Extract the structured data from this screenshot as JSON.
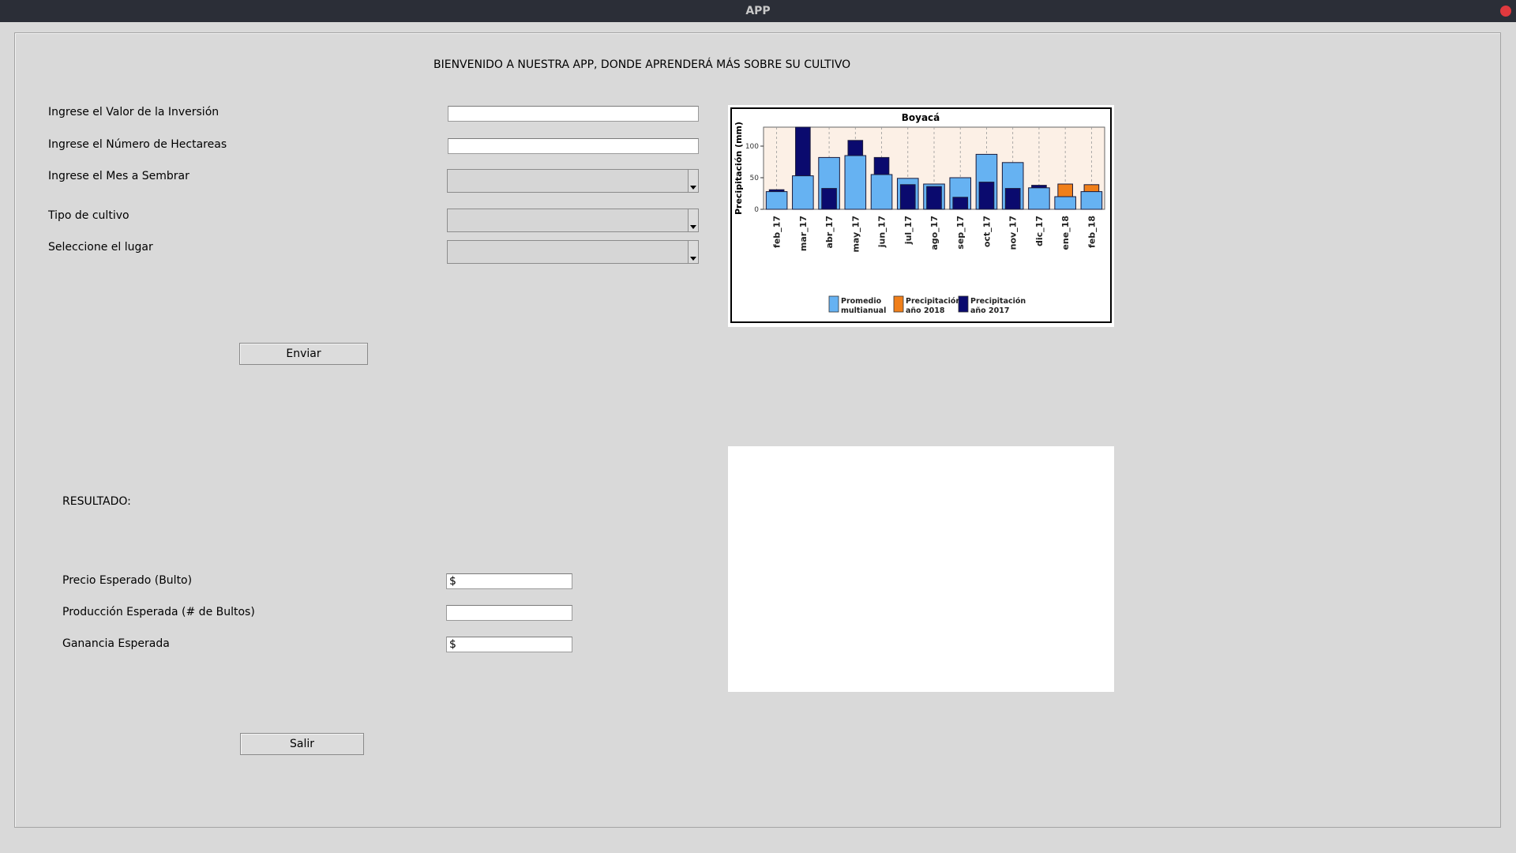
{
  "window": {
    "title": "APP"
  },
  "welcome": "BIENVENIDO A NUESTRA APP, DONDE APRENDERÁ MÁS SOBRE SU CULTIVO",
  "form": {
    "investment_label": "Ingrese el Valor de la Inversión",
    "investment_value": "",
    "hectares_label": "Ingrese el Número de Hectareas",
    "hectares_value": "",
    "month_label": "Ingrese el Mes a Sembrar",
    "month_value": "",
    "crop_label": "Tipo de cultivo",
    "crop_value": "",
    "place_label": "Seleccione el lugar",
    "place_value": "",
    "submit_label": "Enviar"
  },
  "results": {
    "heading": "RESULTADO:",
    "price_label": "Precio Esperado (Bulto)",
    "price_value": "$",
    "production_label": "Producción Esperada (# de Bultos)",
    "production_value": "",
    "profit_label": "Ganancia Esperada",
    "profit_value": "$",
    "exit_label": "Salir"
  },
  "colors": {
    "promedio": "#66b2f2",
    "prec2018": "#f07f1a",
    "prec2017": "#0a0a6e",
    "plot_bg": "#fcf0e6"
  },
  "chart_data": {
    "type": "bar",
    "title": "Boyacá",
    "ylabel": "Precipitación (mm)",
    "ylim": [
      0,
      130
    ],
    "yticks": [
      0,
      50,
      100
    ],
    "categories": [
      "feb_17",
      "mar_17",
      "abr_17",
      "may_17",
      "jun_17",
      "jul_17",
      "ago_17",
      "sep_17",
      "oct_17",
      "nov_17",
      "dic_17",
      "ene_18",
      "feb_18"
    ],
    "series": [
      {
        "name": "Promedio multianual",
        "key": "promedio",
        "values": [
          28,
          53,
          82,
          85,
          55,
          49,
          40,
          50,
          87,
          74,
          34,
          20,
          28
        ]
      },
      {
        "name": "Precipitación año 2018",
        "key": "prec2018",
        "values": [
          null,
          null,
          null,
          null,
          null,
          null,
          null,
          null,
          null,
          null,
          null,
          40,
          39
        ]
      },
      {
        "name": "Precipitación año 2017",
        "key": "prec2017",
        "values": [
          31,
          130,
          33,
          109,
          82,
          39,
          36,
          19,
          43,
          33,
          38,
          null,
          null
        ]
      }
    ],
    "legend": [
      {
        "key": "promedio",
        "line1": "Promedio",
        "line2": "multianual"
      },
      {
        "key": "prec2018",
        "line1": "Precipitación",
        "line2": "año 2018"
      },
      {
        "key": "prec2017",
        "line1": "Precipitación",
        "line2": "año 2017"
      }
    ],
    "legend_position": "bottom",
    "grid": "vertical-dashed"
  }
}
